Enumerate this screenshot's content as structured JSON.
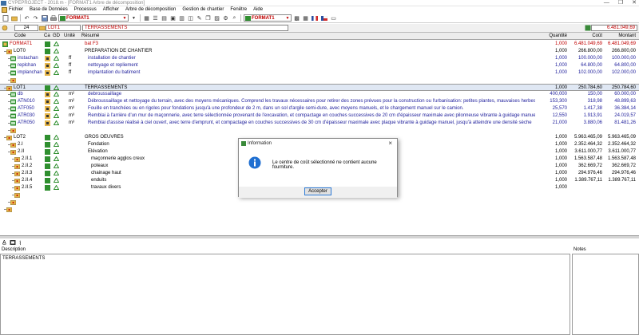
{
  "window": {
    "title": "CYPEPROJECT - 2018.m - [FORMAT1 Arbre de décomposition]",
    "controls": [
      "—",
      "❐",
      "✕"
    ]
  },
  "menu": {
    "items": [
      "Fichier",
      "Base de Données",
      "Processus",
      "Afficher",
      "Arbre de décomposition",
      "Gestion de chantier",
      "Fenêtre",
      "Aide"
    ]
  },
  "toolbar": {
    "combo1": "FORMAT1",
    "combo2": "FORMAT1"
  },
  "filter": {
    "level": "24",
    "code": "LOT1",
    "summary": "TERRASSEMENTS",
    "total": "6.481.049,69"
  },
  "headers": {
    "code": "Code",
    "ca": "Ca",
    "gd": "GD",
    "unit": "Unité",
    "summary": "Résumé",
    "qty": "Quantité",
    "cost": "Coût",
    "amount": "Montant"
  },
  "rows": [
    {
      "code": "FORMAT1",
      "unit": "",
      "summary": "bat F3",
      "qty": "1,000",
      "cost": "6.481.049,69",
      "amount": "6.481.049,69",
      "style": "red",
      "indent": 0
    },
    {
      "code": "LOT0",
      "unit": "",
      "summary": "PREPARATION DE CHANTIER",
      "qty": "1,000",
      "cost": "266.800,00",
      "amount": "266.800,00",
      "style": "black",
      "indent": 1
    },
    {
      "code": "instachan",
      "unit": "ff",
      "summary": "installation de chantier",
      "qty": "1,000",
      "cost": "100.000,00",
      "amount": "100.000,00",
      "style": "blue",
      "indent": 2
    },
    {
      "code": "replchan",
      "unit": "ff",
      "summary": "nettoyage et repliement",
      "qty": "1,000",
      "cost": "64.800,00",
      "amount": "64.800,00",
      "style": "blue",
      "indent": 2
    },
    {
      "code": "implanchan",
      "unit": "ff",
      "summary": "implantation du batiment",
      "qty": "1,000",
      "cost": "102.000,00",
      "amount": "102.000,00",
      "style": "blue",
      "indent": 2
    },
    {
      "code": "",
      "unit": "",
      "summary": "",
      "qty": "",
      "cost": "",
      "amount": "",
      "style": "black",
      "indent": 2
    },
    {
      "code": "LOT1",
      "unit": "",
      "summary": "TERRASSEMENTS",
      "qty": "1,000",
      "cost": "250.784,60",
      "amount": "250.784,60",
      "style": "black",
      "indent": 1,
      "selected": true
    },
    {
      "code": "db",
      "unit": "m²",
      "summary": "debroussaillage",
      "qty": "400,000",
      "cost": "150,00",
      "amount": "60.000,00",
      "style": "blue",
      "indent": 2
    },
    {
      "code": "ATN010",
      "unit": "m²",
      "summary": "Débroussaillage et nettoyage du terrain, avec des moyens mécaniques. Comprend les travaux nécessaires pour retirer des zones prévues pour la construction ou l'urbanisation: petites plantes, mauvaises herbes, broussailles, racines ou tout autre",
      "qty": "153,300",
      "cost": "318,98",
      "amount": "48.899,63",
      "style": "blue",
      "indent": 2
    },
    {
      "code": "ATF050",
      "unit": "m³",
      "summary": "Fouille en tranchées ou en rigoles pour fondations jusqu'à une profondeur de 2 m, dans un sol d'argile semi-dure, avec moyens manuels, et le chargement manuel sur le camion.",
      "qty": "25,570",
      "cost": "1.417,38",
      "amount": "36.384,14",
      "style": "blue",
      "indent": 2
    },
    {
      "code": "ATR030",
      "unit": "m³",
      "summary": "Remblai à l'arrière d'un mur de maçonnerie, avec terre sélectionnée provenant de l'excavation, et compactage en couches successives de 20 cm d'épaisseur maximale avec pilonneuse vibrante à guidage manuel",
      "qty": "12,550",
      "cost": "1.913,91",
      "amount": "24.019,57",
      "style": "blue",
      "indent": 2
    },
    {
      "code": "ATR050",
      "unit": "m³",
      "summary": "Remblai d'assise réalisé à ciel ouvert, avec terre d'emprunt, et compactage en couches successives de 30 cm d'épaisseur maximale avec plaque vibrante à guidage manuel, jusqu'à atteindre une densité sèche",
      "qty": "21,000",
      "cost": "3.880,06",
      "amount": "81.481,26",
      "style": "blue",
      "indent": 2
    },
    {
      "code": "",
      "unit": "",
      "summary": "",
      "qty": "",
      "cost": "",
      "amount": "",
      "style": "black",
      "indent": 2
    },
    {
      "code": "LOT2",
      "unit": "",
      "summary": "GROS OEUVRES",
      "qty": "1,000",
      "cost": "5.963.465,09",
      "amount": "5.963.465,09",
      "style": "black",
      "indent": 1
    },
    {
      "code": "2.I",
      "unit": "",
      "summary": "Fondation",
      "qty": "1,000",
      "cost": "2.352.464,32",
      "amount": "2.352.464,32",
      "style": "black",
      "indent": 2
    },
    {
      "code": "2.II",
      "unit": "",
      "summary": "Elévation",
      "qty": "1,000",
      "cost": "3.611.000,77",
      "amount": "3.611.000,77",
      "style": "black",
      "indent": 2
    },
    {
      "code": "2.II.1",
      "unit": "",
      "summary": "maçonnerie agglos creux",
      "qty": "1,000",
      "cost": "1.563.587,48",
      "amount": "1.563.587,48",
      "style": "black",
      "indent": 3
    },
    {
      "code": "2.II.2",
      "unit": "",
      "summary": "poteaux",
      "qty": "1,000",
      "cost": "362.669,72",
      "amount": "362.669,72",
      "style": "black",
      "indent": 3
    },
    {
      "code": "2.II.3",
      "unit": "",
      "summary": "chainage haut",
      "qty": "1,000",
      "cost": "294.976,46",
      "amount": "294.976,46",
      "style": "black",
      "indent": 3
    },
    {
      "code": "2.II.4",
      "unit": "",
      "summary": "enduits",
      "qty": "1,000",
      "cost": "1.389.767,11",
      "amount": "1.389.767,11",
      "style": "black",
      "indent": 3
    },
    {
      "code": "2.II.5",
      "unit": "",
      "summary": "travaux divers",
      "qty": "1,000",
      "cost": "",
      "amount": "",
      "style": "black",
      "indent": 3
    },
    {
      "code": "",
      "unit": "",
      "summary": "",
      "qty": "",
      "cost": "",
      "amount": "",
      "style": "black",
      "indent": 3
    },
    {
      "code": "",
      "unit": "",
      "summary": "",
      "qty": "",
      "cost": "",
      "amount": "",
      "style": "black",
      "indent": 2
    },
    {
      "code": "",
      "unit": "",
      "summary": "",
      "qty": "",
      "cost": "",
      "amount": "",
      "style": "black",
      "indent": 1
    }
  ],
  "panel": {
    "description_label": "Description",
    "notes_label": "Notes",
    "description_text": "TERRASSEMENTS"
  },
  "dialog": {
    "title": "Information",
    "message": "Le centre de coût sélectionné ne contient aucune fourniture.",
    "ok": "Accepter"
  },
  "colors": {
    "red": "#c00000",
    "blue": "#1d1d9b",
    "selection": "#dfe7f3",
    "folder": "#e6b64a"
  }
}
